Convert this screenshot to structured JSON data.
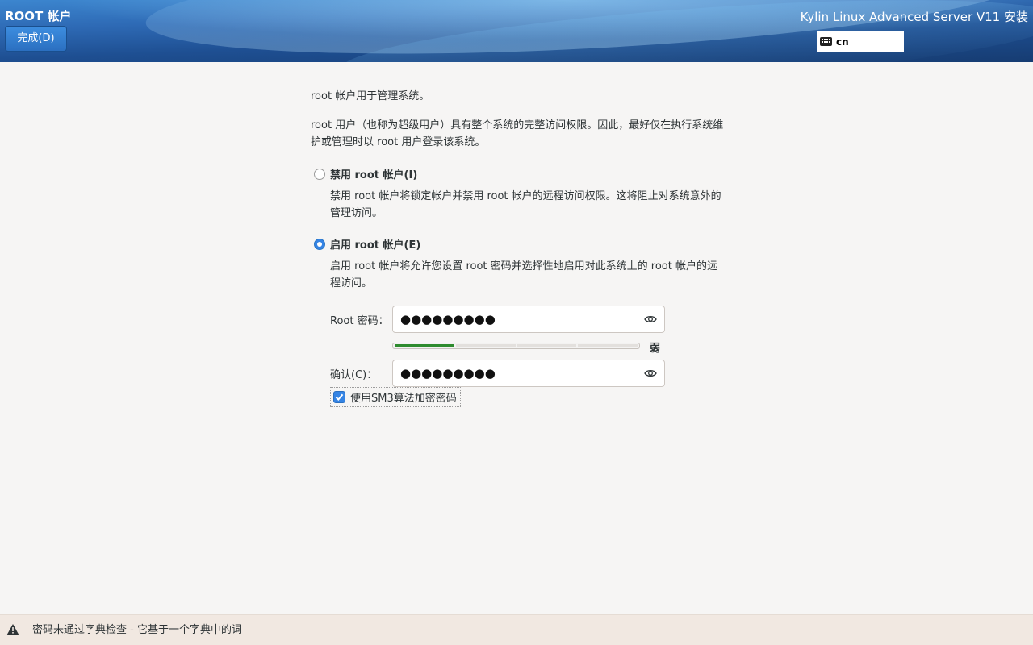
{
  "header": {
    "page_title": "ROOT 帐户",
    "done_button": "完成(D)",
    "product_title": "Kylin Linux Advanced Server V11 安装",
    "keyboard_layout": "cn"
  },
  "intro": {
    "line1": "root 帐户用于管理系统。",
    "line2": "root 用户（也称为超级用户）具有整个系统的完整访问权限。因此，最好仅在执行系统维护或管理时以 root 用户登录该系统。"
  },
  "options": {
    "disable": {
      "label": "禁用 root 帐户(I)",
      "description": "禁用 root 帐户将锁定帐户并禁用 root 帐户的远程访问权限。这将阻止对系统意外的管理访问。",
      "selected": false
    },
    "enable": {
      "label": "启用 root 帐户(E)",
      "description": "启用 root 帐户将允许您设置 root 密码并选择性地启用对此系统上的 root 帐户的远程访问。",
      "selected": true
    }
  },
  "password": {
    "label": "Root 密码：",
    "masked_value": "●●●●●●●●●",
    "strength_fraction": 0.25,
    "strength_label": "弱"
  },
  "confirm": {
    "label": "确认(C)：",
    "masked_value": "●●●●●●●●●"
  },
  "sm3_checkbox": {
    "label": "使用SM3算法加密密码",
    "checked": true
  },
  "warning": {
    "text": "密码未通过字典检查 - 它基于一个字典中的词"
  },
  "colors": {
    "accent": "#3584e4",
    "strength_bar": "#2e8b2e",
    "warning_bg": "#f1e8e1"
  }
}
